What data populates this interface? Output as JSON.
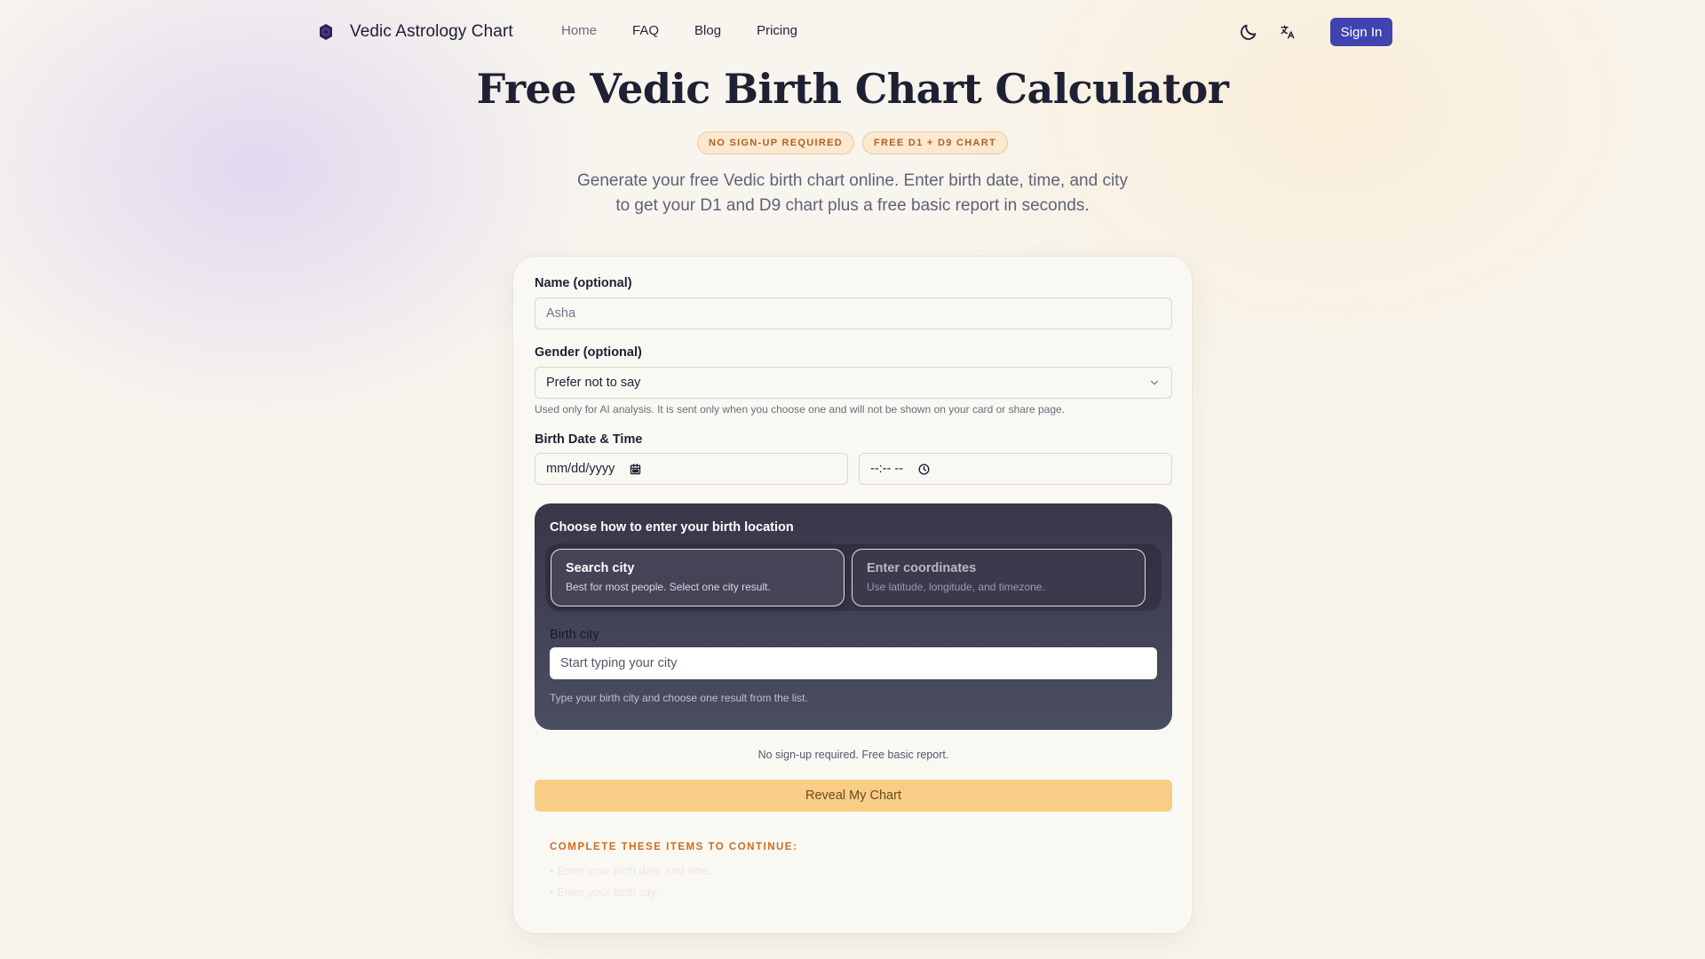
{
  "nav": {
    "brand": "Vedic Astrology Chart",
    "links": [
      {
        "label": "Home",
        "active": true
      },
      {
        "label": "FAQ",
        "active": false
      },
      {
        "label": "Blog",
        "active": false
      },
      {
        "label": "Pricing",
        "active": false
      }
    ],
    "theme_icon": "moon-icon",
    "language_icon": "translate-icon",
    "sign_in": "Sign In"
  },
  "hero": {
    "title": "Free Vedic Birth Chart Calculator",
    "badges": [
      "NO SIGN-UP REQUIRED",
      "FREE D1 + D9 CHART"
    ],
    "subtitle": "Generate your free Vedic birth chart online. Enter birth date, time, and city to get your D1 and D9 chart plus a free basic report in seconds."
  },
  "form": {
    "name_label": "Name (optional)",
    "name_placeholder": "Asha",
    "gender_label": "Gender (optional)",
    "gender_value": "Prefer not to say",
    "gender_help": "Used only for AI analysis. It is sent only when you choose one and will not be shown on your card or share page.",
    "datetime_label": "Birth Date & Time",
    "date_placeholder": "mm/dd/yyyy",
    "time_placeholder": "--:-- --",
    "location": {
      "heading": "Choose how to enter your birth location",
      "options": [
        {
          "title": "Search city",
          "description": "Best for most people. Select one city result.",
          "selected": true
        },
        {
          "title": "Enter coordinates",
          "description": "Use latitude, longitude, and timezone.",
          "selected": false
        }
      ],
      "city_label": "Birth city",
      "city_placeholder": "Start typing your city",
      "city_help": "Type your birth city and choose one result from the list."
    },
    "note": "No sign-up required. Free basic report.",
    "submit": "Reveal My Chart",
    "todo_title": "COMPLETE THESE ITEMS TO CONTINUE:",
    "todo_items": [
      "• Enter your birth date and time.",
      "• Enter your birth city."
    ]
  },
  "colors": {
    "primary": "#3f44b0",
    "cta": "#f9cd86",
    "badge_text": "#b1611e",
    "badge_bg": "#fbe8d1",
    "panel_dark": "#3a3649"
  }
}
